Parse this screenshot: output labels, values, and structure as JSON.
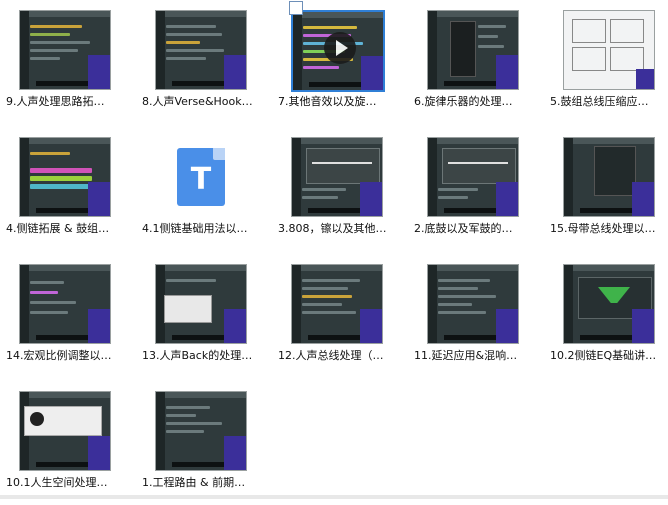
{
  "files": [
    {
      "label": "9.人声处理思路拓…",
      "style": "daw"
    },
    {
      "label": "8.人声Verse&Hook…",
      "style": "daw"
    },
    {
      "label": "7.其他音效以及旋…",
      "style": "daw-play",
      "selected": true
    },
    {
      "label": "6.旋律乐器的处理…",
      "style": "daw-plugin"
    },
    {
      "label": "5.鼓组总线压缩应…",
      "style": "white"
    },
    {
      "label": "4.侧链拓展 & 鼓组…",
      "style": "daw-colored"
    },
    {
      "label": "4.1侧链基础用法以…",
      "style": "doc"
    },
    {
      "label": "3.808，镲以及其他…",
      "style": "daw-eq"
    },
    {
      "label": "2.底鼓以及军鼓的…",
      "style": "daw-eq"
    },
    {
      "label": "15.母带总线处理以…",
      "style": "daw-dark"
    },
    {
      "label": "14.宏观比例调整以…",
      "style": "daw"
    },
    {
      "label": "13.人声Back的处理…",
      "style": "daw-window"
    },
    {
      "label": "12.人声总线处理（…",
      "style": "daw"
    },
    {
      "label": "11.延迟应用&混响…",
      "style": "daw"
    },
    {
      "label": "10.2侧链EQ基础讲…",
      "style": "daw-green"
    },
    {
      "label": "10.1人生空间处理…",
      "style": "white-plugin"
    },
    {
      "label": "1.工程路由 & 前期…",
      "style": "daw"
    }
  ],
  "icons": {
    "doc_letter": "T"
  }
}
